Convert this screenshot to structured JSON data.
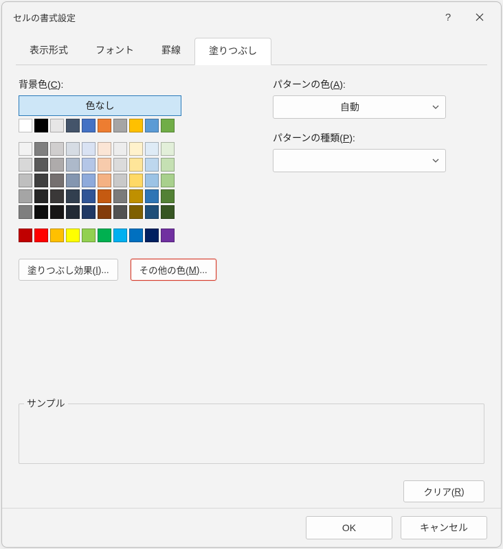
{
  "title": "セルの書式設定",
  "help_tooltip": "ヘルプ",
  "close_tooltip": "閉じる",
  "tabs": [
    {
      "label": "表示形式",
      "selected": false
    },
    {
      "label": "フォント",
      "selected": false
    },
    {
      "label": "罫線",
      "selected": false
    },
    {
      "label": "塗りつぶし",
      "selected": true
    }
  ],
  "fill": {
    "bg_label_pre": "背景色(",
    "bg_mnemonic": "C",
    "bg_label_post": "):",
    "no_color": "色なし",
    "effect_btn_pre": "塗りつぶし効果(",
    "effect_mnemonic": "I",
    "effect_btn_post": ")...",
    "more_btn_pre": "その他の色(",
    "more_mnemonic": "M",
    "more_btn_post": ")..."
  },
  "pattern": {
    "color_label_pre": "パターンの色(",
    "color_mnemonic": "A",
    "color_label_post": "):",
    "color_value": "自動",
    "type_label_pre": "パターンの種類(",
    "type_mnemonic": "P",
    "type_label_post": "):",
    "type_value": ""
  },
  "sample_label": "サンプル",
  "clear_btn_pre": "クリア(",
  "clear_mnemonic": "R",
  "clear_btn_post": ")",
  "footer": {
    "ok": "OK",
    "cancel": "キャンセル"
  },
  "palette": {
    "row1": [
      "#ffffff",
      "#000000",
      "#e7e6e6",
      "#44546a",
      "#4472c4",
      "#ed7d31",
      "#a5a5a5",
      "#ffc000",
      "#5b9bd5",
      "#70ad47"
    ],
    "group2": [
      [
        "#f2f2f2",
        "#7f7f7f",
        "#d0cece",
        "#d6dce4",
        "#d9e2f3",
        "#fbe5d5",
        "#ededed",
        "#fff2cc",
        "#deebf6",
        "#e2efd9"
      ],
      [
        "#d8d8d8",
        "#595959",
        "#aeabab",
        "#adb9ca",
        "#b4c6e7",
        "#f7cbac",
        "#dbdbdb",
        "#fee599",
        "#bdd7ee",
        "#c5e0b3"
      ],
      [
        "#bfbfbf",
        "#3f3f3f",
        "#757070",
        "#8496b0",
        "#8eaadb",
        "#f4b183",
        "#c9c9c9",
        "#ffd965",
        "#9cc3e5",
        "#a8d08d"
      ],
      [
        "#a5a5a5",
        "#262626",
        "#3a3838",
        "#323f4f",
        "#2f5496",
        "#c55a11",
        "#7b7b7b",
        "#bf9000",
        "#2e75b5",
        "#538135"
      ],
      [
        "#7f7f7f",
        "#0c0c0c",
        "#171616",
        "#222a35",
        "#1f3864",
        "#833c0b",
        "#525252",
        "#7f6000",
        "#1e4e79",
        "#375623"
      ]
    ],
    "row3": [
      "#c00000",
      "#ff0000",
      "#ffc000",
      "#ffff00",
      "#92d050",
      "#00b050",
      "#00b0f0",
      "#0070c0",
      "#002060",
      "#7030a0"
    ]
  }
}
